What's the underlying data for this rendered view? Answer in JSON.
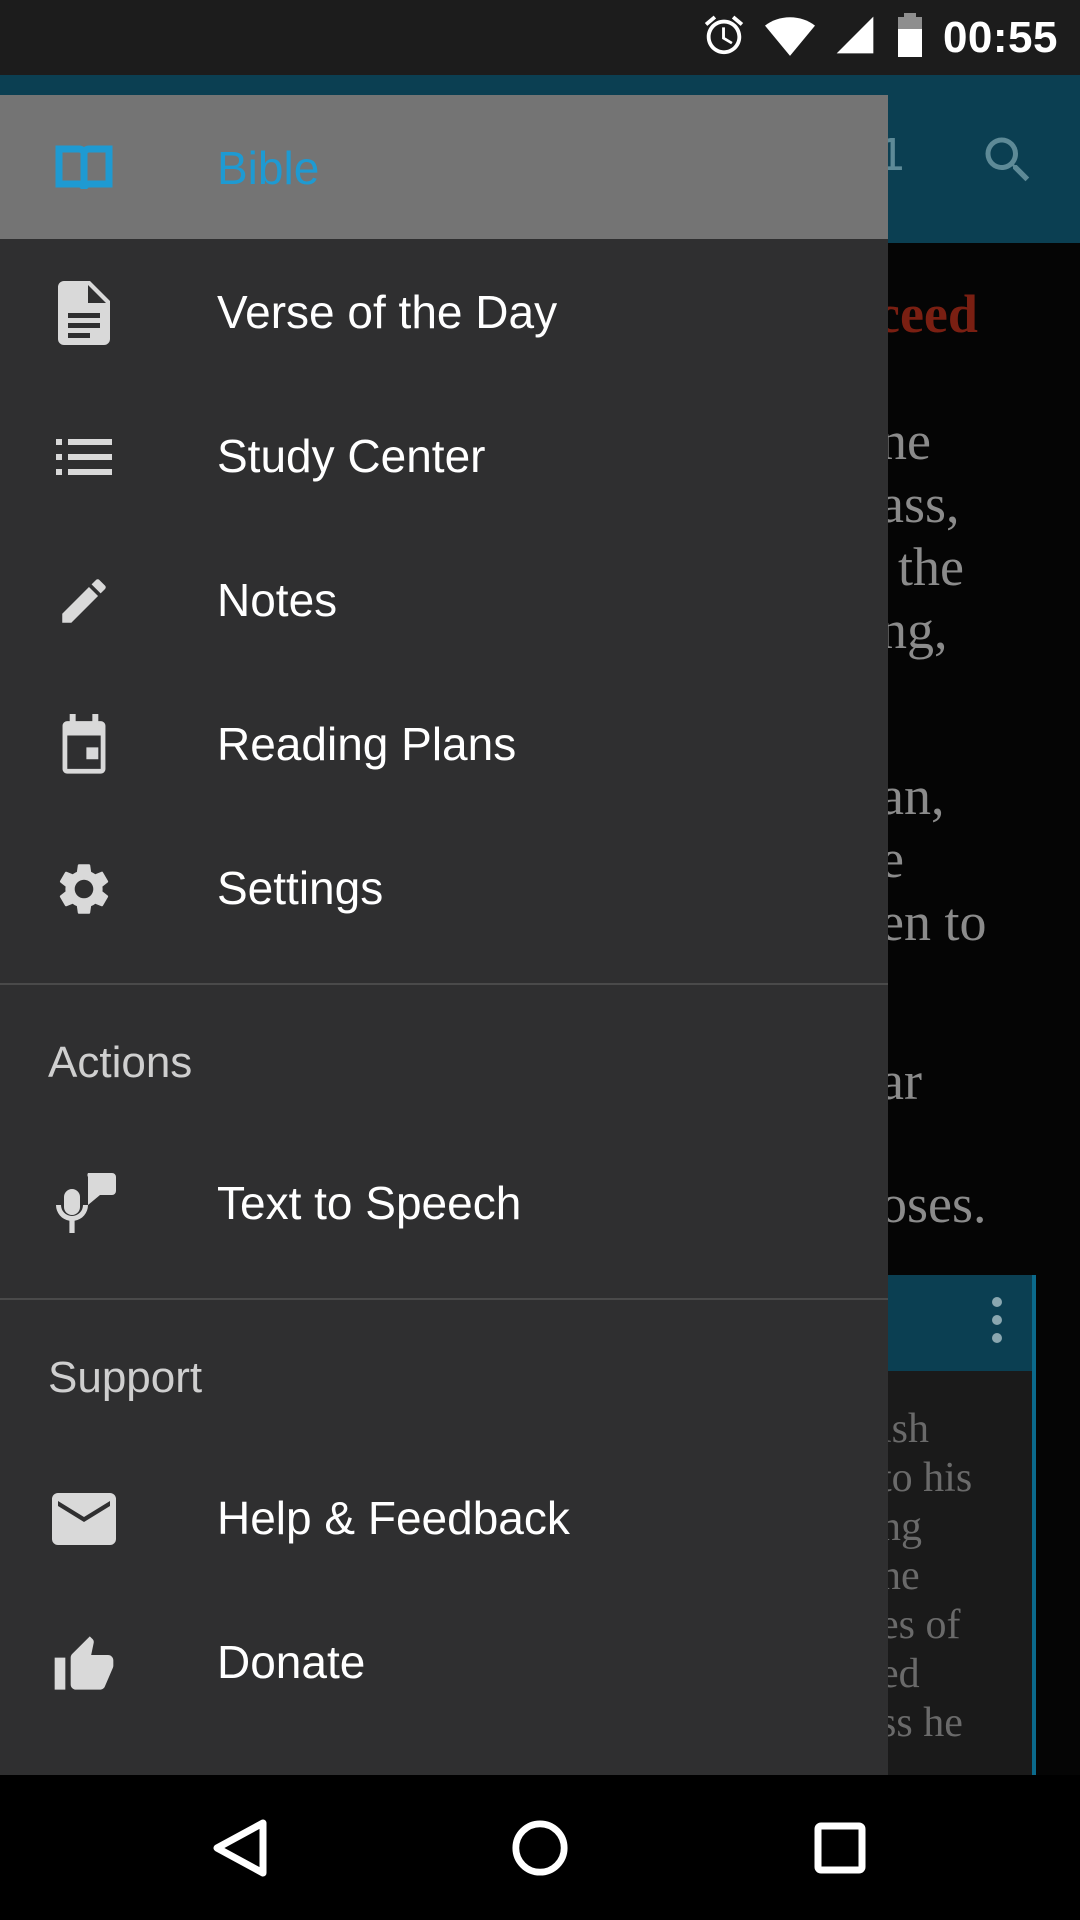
{
  "status_bar": {
    "time": "00:55",
    "icons": [
      "alarm-icon",
      "wifi-icon",
      "cell-signal-icon",
      "battery-icon"
    ]
  },
  "background": {
    "chapter_fragment": "1",
    "heading_fragment": "ceed",
    "text_lines": [
      "ne",
      "ass,",
      "the",
      "ng,",
      "an,",
      "e",
      "en to",
      "ar",
      "oses."
    ],
    "card_lines": [
      "ish",
      "to his",
      "ng",
      "ne",
      "es of",
      "ed",
      "ss he"
    ]
  },
  "drawer": {
    "items": [
      {
        "label": "Bible",
        "icon": "book-icon",
        "selected": true
      },
      {
        "label": "Verse of the Day",
        "icon": "document-icon",
        "selected": false
      },
      {
        "label": "Study Center",
        "icon": "list-icon",
        "selected": false
      },
      {
        "label": "Notes",
        "icon": "pencil-icon",
        "selected": false
      },
      {
        "label": "Reading Plans",
        "icon": "calendar-icon",
        "selected": false
      },
      {
        "label": "Settings",
        "icon": "gear-icon",
        "selected": false
      }
    ],
    "actions": {
      "header": "Actions",
      "items": [
        {
          "label": "Text to Speech",
          "icon": "speech-icon"
        }
      ]
    },
    "support": {
      "header": "Support",
      "items": [
        {
          "label": "Help & Feedback",
          "icon": "mail-icon"
        },
        {
          "label": "Donate",
          "icon": "thumbs-up-icon"
        }
      ]
    }
  },
  "colors": {
    "accent": "#1e9ad2",
    "drawer_bg": "#2f2f30",
    "selected_bg": "#747474",
    "toolbar": "#0b3f52"
  }
}
